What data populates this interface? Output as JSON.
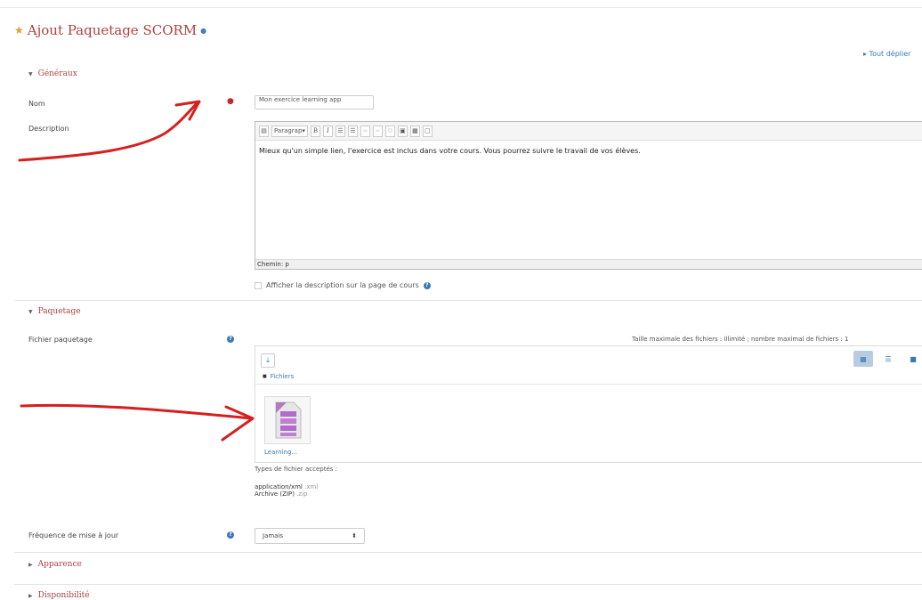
{
  "page": {
    "title": "Ajout Paquetage SCORM",
    "expand_all": "▸ Tout déplier"
  },
  "sections": {
    "general": "Généraux",
    "package": "Paquetage",
    "appearance": "Apparence",
    "availability": "Disponibilité"
  },
  "form": {
    "name_label": "Nom",
    "name_value": "Mon exercice learning app",
    "description_label": "Description",
    "editor": {
      "paragraph_select": "Paragrap",
      "text": "Mieux qu'un simple lien, l'exercice est inclus dans votre cours. Vous pourrez suivre le travail de vos élèves.",
      "path": "Chemin: p"
    },
    "show_description": "Afficher la description sur la page de cours",
    "package_label": "Fichier paquetage",
    "max_size": "Taille maximale des fichiers : Illimité ; nombre maximal de fichiers : 1",
    "file_manager": {
      "breadcrumb": "Fichiers",
      "file_name": "Learning..."
    },
    "accepted_types_label": "Types de fichier acceptés :",
    "accepted_types": [
      {
        "name": "application/xml",
        "ext": ".xml"
      },
      {
        "name": "Archive (ZIP)",
        "ext": ".zip"
      }
    ],
    "update_freq_label": "Fréquence de mise à jour",
    "update_freq_value": "Jamais"
  },
  "colors": {
    "accent_red": "#b0413e",
    "link_blue": "#3a7bbf",
    "annotation_red": "#d61f1f"
  }
}
